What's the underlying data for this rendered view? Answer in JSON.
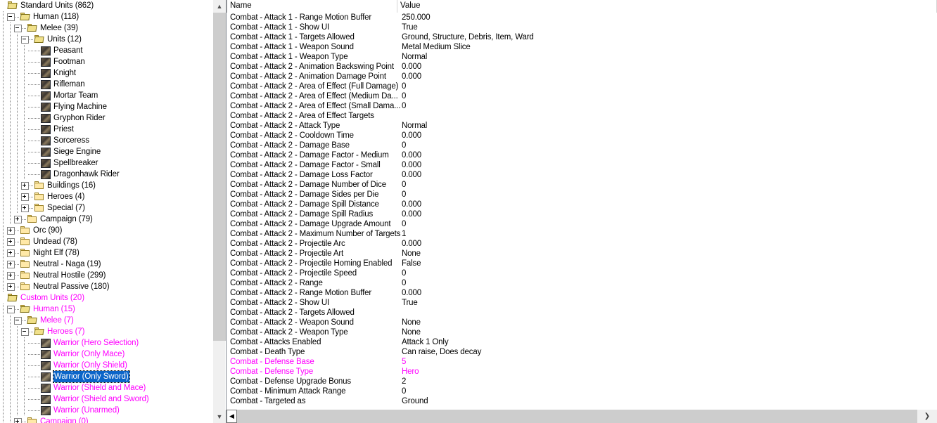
{
  "tree": {
    "scrollbar": {
      "up_icon": "chevron-up-icon",
      "down_icon": "chevron-down-icon"
    },
    "items": [
      {
        "label": "Standard Units (862)",
        "depth": 0,
        "type": "folder-open",
        "expander": "none",
        "custom": false
      },
      {
        "label": "Human (118)",
        "depth": 1,
        "type": "folder-open",
        "expander": "minus",
        "custom": false
      },
      {
        "label": "Melee (39)",
        "depth": 2,
        "type": "folder-open",
        "expander": "minus",
        "custom": false
      },
      {
        "label": "Units (12)",
        "depth": 3,
        "type": "folder-open",
        "expander": "minus",
        "custom": false
      },
      {
        "label": "Peasant",
        "depth": 4,
        "type": "unit",
        "expander": "none",
        "custom": false
      },
      {
        "label": "Footman",
        "depth": 4,
        "type": "unit",
        "expander": "none",
        "custom": false
      },
      {
        "label": "Knight",
        "depth": 4,
        "type": "unit",
        "expander": "none",
        "custom": false
      },
      {
        "label": "Rifleman",
        "depth": 4,
        "type": "unit",
        "expander": "none",
        "custom": false
      },
      {
        "label": "Mortar Team",
        "depth": 4,
        "type": "unit",
        "expander": "none",
        "custom": false
      },
      {
        "label": "Flying Machine",
        "depth": 4,
        "type": "unit",
        "expander": "none",
        "custom": false
      },
      {
        "label": "Gryphon Rider",
        "depth": 4,
        "type": "unit",
        "expander": "none",
        "custom": false
      },
      {
        "label": "Priest",
        "depth": 4,
        "type": "unit",
        "expander": "none",
        "custom": false
      },
      {
        "label": "Sorceress",
        "depth": 4,
        "type": "unit",
        "expander": "none",
        "custom": false
      },
      {
        "label": "Siege Engine",
        "depth": 4,
        "type": "unit",
        "expander": "none",
        "custom": false
      },
      {
        "label": "Spellbreaker",
        "depth": 4,
        "type": "unit",
        "expander": "none",
        "custom": false
      },
      {
        "label": "Dragonhawk Rider",
        "depth": 4,
        "type": "unit",
        "expander": "none",
        "custom": false
      },
      {
        "label": "Buildings (16)",
        "depth": 3,
        "type": "folder",
        "expander": "plus",
        "custom": false
      },
      {
        "label": "Heroes (4)",
        "depth": 3,
        "type": "folder",
        "expander": "plus",
        "custom": false
      },
      {
        "label": "Special (7)",
        "depth": 3,
        "type": "folder",
        "expander": "plus",
        "custom": false
      },
      {
        "label": "Campaign (79)",
        "depth": 2,
        "type": "folder",
        "expander": "plus",
        "custom": false
      },
      {
        "label": "Orc (90)",
        "depth": 1,
        "type": "folder",
        "expander": "plus",
        "custom": false
      },
      {
        "label": "Undead (78)",
        "depth": 1,
        "type": "folder",
        "expander": "plus",
        "custom": false
      },
      {
        "label": "Night Elf (78)",
        "depth": 1,
        "type": "folder",
        "expander": "plus",
        "custom": false
      },
      {
        "label": "Neutral - Naga (19)",
        "depth": 1,
        "type": "folder",
        "expander": "plus",
        "custom": false
      },
      {
        "label": "Neutral Hostile (299)",
        "depth": 1,
        "type": "folder",
        "expander": "plus",
        "custom": false
      },
      {
        "label": "Neutral Passive (180)",
        "depth": 1,
        "type": "folder",
        "expander": "plus",
        "custom": false
      },
      {
        "label": "Custom Units (20)",
        "depth": 0,
        "type": "folder-open",
        "expander": "none",
        "custom": true
      },
      {
        "label": "Human (15)",
        "depth": 1,
        "type": "folder-open",
        "expander": "minus",
        "custom": true
      },
      {
        "label": "Melee (7)",
        "depth": 2,
        "type": "folder-open",
        "expander": "minus",
        "custom": true
      },
      {
        "label": "Heroes (7)",
        "depth": 3,
        "type": "folder-open",
        "expander": "minus",
        "custom": true
      },
      {
        "label": "Warrior (Hero Selection)",
        "depth": 4,
        "type": "hero",
        "expander": "none",
        "custom": true
      },
      {
        "label": "Warrior (Only Mace)",
        "depth": 4,
        "type": "hero",
        "expander": "none",
        "custom": true
      },
      {
        "label": "Warrior (Only Shield)",
        "depth": 4,
        "type": "hero",
        "expander": "none",
        "custom": true
      },
      {
        "label": "Warrior (Only Sword)",
        "depth": 4,
        "type": "hero",
        "expander": "none",
        "custom": true,
        "selected": true
      },
      {
        "label": "Warrior (Shield and Mace)",
        "depth": 4,
        "type": "hero",
        "expander": "none",
        "custom": true
      },
      {
        "label": "Warrior (Shield and Sword)",
        "depth": 4,
        "type": "hero",
        "expander": "none",
        "custom": true
      },
      {
        "label": "Warrior (Unarmed)",
        "depth": 4,
        "type": "hero",
        "expander": "none",
        "custom": true
      },
      {
        "label": "Campaign (0)",
        "depth": 2,
        "type": "folder",
        "expander": "plus",
        "custom": true
      }
    ]
  },
  "grid": {
    "columns": {
      "name": "Name",
      "value": "Value"
    },
    "rows": [
      {
        "name": "Combat - Attack 1 - Range Motion Buffer",
        "value": "250.000",
        "custom": false
      },
      {
        "name": "Combat - Attack 1 - Show UI",
        "value": "True",
        "custom": false
      },
      {
        "name": "Combat - Attack 1 - Targets Allowed",
        "value": "Ground, Structure, Debris, Item, Ward",
        "custom": false
      },
      {
        "name": "Combat - Attack 1 - Weapon Sound",
        "value": "Metal Medium Slice",
        "custom": false
      },
      {
        "name": "Combat - Attack 1 - Weapon Type",
        "value": "Normal",
        "custom": false
      },
      {
        "name": "Combat - Attack 2 - Animation Backswing Point",
        "value": "0.000",
        "custom": false
      },
      {
        "name": "Combat - Attack 2 - Animation Damage Point",
        "value": "0.000",
        "custom": false
      },
      {
        "name": "Combat - Attack 2 - Area of Effect (Full Damage)",
        "value": "0",
        "custom": false
      },
      {
        "name": "Combat - Attack 2 - Area of Effect (Medium Da...",
        "value": "0",
        "custom": false
      },
      {
        "name": "Combat - Attack 2 - Area of Effect (Small Dama...",
        "value": "0",
        "custom": false
      },
      {
        "name": "Combat - Attack 2 - Area of Effect Targets",
        "value": "",
        "custom": false
      },
      {
        "name": "Combat - Attack 2 - Attack Type",
        "value": "Normal",
        "custom": false
      },
      {
        "name": "Combat - Attack 2 - Cooldown Time",
        "value": "0.000",
        "custom": false
      },
      {
        "name": "Combat - Attack 2 - Damage Base",
        "value": "0",
        "custom": false
      },
      {
        "name": "Combat - Attack 2 - Damage Factor - Medium",
        "value": "0.000",
        "custom": false
      },
      {
        "name": "Combat - Attack 2 - Damage Factor - Small",
        "value": "0.000",
        "custom": false
      },
      {
        "name": "Combat - Attack 2 - Damage Loss Factor",
        "value": "0.000",
        "custom": false
      },
      {
        "name": "Combat - Attack 2 - Damage Number of Dice",
        "value": "0",
        "custom": false
      },
      {
        "name": "Combat - Attack 2 - Damage Sides per Die",
        "value": "0",
        "custom": false
      },
      {
        "name": "Combat - Attack 2 - Damage Spill Distance",
        "value": "0.000",
        "custom": false
      },
      {
        "name": "Combat - Attack 2 - Damage Spill Radius",
        "value": "0.000",
        "custom": false
      },
      {
        "name": "Combat - Attack 2 - Damage Upgrade Amount",
        "value": "0",
        "custom": false
      },
      {
        "name": "Combat - Attack 2 - Maximum Number of Targets",
        "value": "1",
        "custom": false
      },
      {
        "name": "Combat - Attack 2 - Projectile Arc",
        "value": "0.000",
        "custom": false
      },
      {
        "name": "Combat - Attack 2 - Projectile Art",
        "value": "None",
        "custom": false
      },
      {
        "name": "Combat - Attack 2 - Projectile Homing Enabled",
        "value": "False",
        "custom": false
      },
      {
        "name": "Combat - Attack 2 - Projectile Speed",
        "value": "0",
        "custom": false
      },
      {
        "name": "Combat - Attack 2 - Range",
        "value": "0",
        "custom": false
      },
      {
        "name": "Combat - Attack 2 - Range Motion Buffer",
        "value": "0.000",
        "custom": false
      },
      {
        "name": "Combat - Attack 2 - Show UI",
        "value": "True",
        "custom": false
      },
      {
        "name": "Combat - Attack 2 - Targets Allowed",
        "value": "",
        "custom": false
      },
      {
        "name": "Combat - Attack 2 - Weapon Sound",
        "value": "None",
        "custom": false
      },
      {
        "name": "Combat - Attack 2 - Weapon Type",
        "value": "None",
        "custom": false
      },
      {
        "name": "Combat - Attacks Enabled",
        "value": "Attack 1 Only",
        "custom": false
      },
      {
        "name": "Combat - Death Type",
        "value": "Can raise, Does decay",
        "custom": false
      },
      {
        "name": "Combat - Defense Base",
        "value": "5",
        "custom": true
      },
      {
        "name": "Combat - Defense Type",
        "value": "Hero",
        "custom": true
      },
      {
        "name": "Combat - Defense Upgrade Bonus",
        "value": "2",
        "custom": false
      },
      {
        "name": "Combat - Minimum Attack Range",
        "value": "0",
        "custom": false
      },
      {
        "name": "Combat - Targeted as",
        "value": "Ground",
        "custom": false
      }
    ],
    "hscroll": {
      "left_icon": "scroll-left-icon",
      "right_icon": "scroll-right-icon"
    }
  },
  "colors": {
    "custom_text": "#ff00ff",
    "selection_bg": "#0a64c8",
    "selection_text": "#ffffff",
    "scroll_thumb": "#cdcdcd"
  }
}
